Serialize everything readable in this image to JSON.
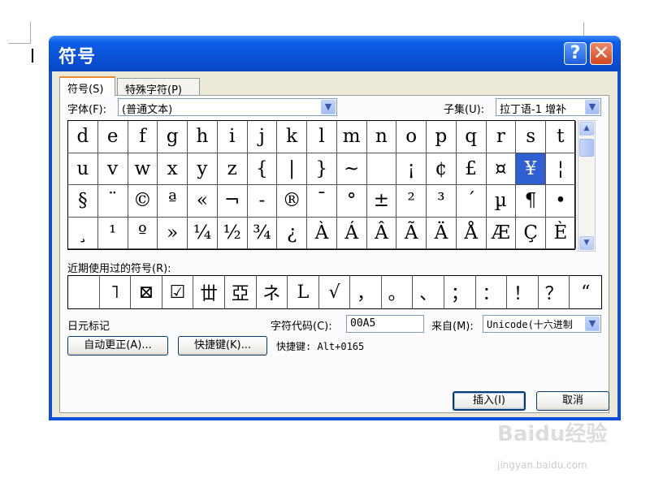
{
  "dialog": {
    "title": "符号",
    "help_icon": "?",
    "close_icon": "✕",
    "tabs": [
      {
        "label": "符号(S)"
      },
      {
        "label": "特殊字符(P)"
      }
    ],
    "font_label": "字体(F):",
    "font_value": "(普通文本)",
    "subset_label": "子集(U):",
    "subset_value": "拉丁语-1 增补",
    "grid_rows": [
      [
        "d",
        "e",
        "f",
        "g",
        "h",
        "i",
        "j",
        "k",
        "l",
        "m",
        "n",
        "o",
        "p",
        "q",
        "r",
        "s",
        "t"
      ],
      [
        "u",
        "v",
        "w",
        "x",
        "y",
        "z",
        "{",
        "|",
        "}",
        "~",
        " ",
        "¡",
        "¢",
        "£",
        "¤",
        "¥",
        "¦"
      ],
      [
        "§",
        "¨",
        "©",
        "ª",
        "«",
        "¬",
        "-",
        "®",
        "¯",
        "°",
        "±",
        "²",
        "³",
        "´",
        "µ",
        "¶",
        "•"
      ],
      [
        "¸",
        "¹",
        "º",
        "»",
        "¼",
        "½",
        "¾",
        "¿",
        "À",
        "Á",
        "Â",
        "Ã",
        "Ä",
        "Å",
        "Æ",
        "Ç",
        "È"
      ]
    ],
    "selected_char": "¥",
    "recent_label": "近期使用过的符号(R):",
    "recent": [
      " ",
      "˥",
      "⊠",
      "☑",
      "丗",
      "亞",
      "ネ",
      "L",
      "√",
      "，",
      "。",
      "、",
      "；",
      "：",
      "！",
      "？",
      "“"
    ],
    "char_name": "日元标记",
    "char_code_label": "字符代码(C):",
    "char_code_value": "00A5",
    "from_label": "来自(M):",
    "from_value": "Unicode(十六进制",
    "autocorrect_button": "自动更正(A)...",
    "shortcut_button": "快捷键(K)...",
    "shortcut_text": "快捷键: Alt+0165",
    "insert_button": "插入(I)",
    "cancel_button": "取消"
  },
  "watermark": {
    "logo": "Baidu经验",
    "url": "jingyan.baidu.com"
  }
}
